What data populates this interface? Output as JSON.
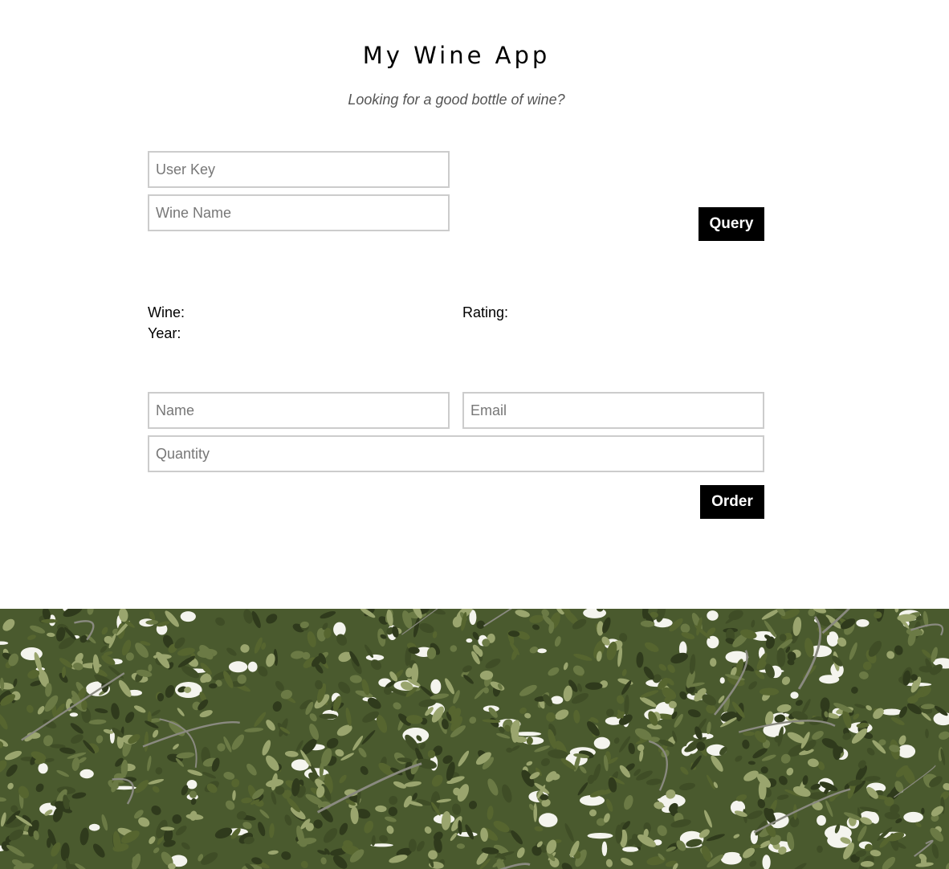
{
  "header": {
    "title": "My Wine App",
    "subtitle": "Looking for a good bottle of wine?"
  },
  "query_form": {
    "user_key_placeholder": "User Key",
    "wine_name_placeholder": "Wine Name",
    "query_button_label": "Query"
  },
  "results": {
    "wine_label": "Wine:",
    "rating_label": "Rating:",
    "year_label": "Year:"
  },
  "order_form": {
    "name_placeholder": "Name",
    "email_placeholder": "Email",
    "quantity_placeholder": "Quantity",
    "order_button_label": "Order"
  },
  "colors": {
    "button_bg": "#000000",
    "button_text": "#ffffff",
    "field_border": "#cccccc",
    "foliage_dark": "#3f4d26",
    "foliage_mid": "#6b7a45",
    "foliage_light": "#9aa56e"
  }
}
